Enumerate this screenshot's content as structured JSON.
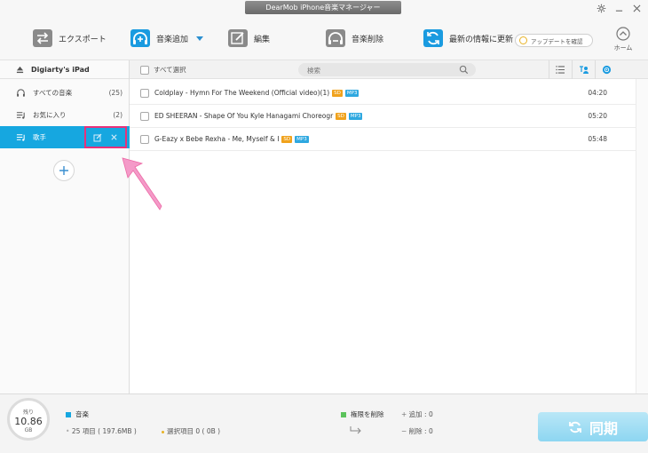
{
  "window": {
    "title": "DearMob iPhone音楽マネージャー"
  },
  "toolbar": {
    "export_label": "エクスポート",
    "add_label": "音楽追加",
    "edit_label": "編集",
    "delete_label": "音楽削除",
    "refresh_label": "最新の情報に更新",
    "update_label": "アップデートを確認",
    "home_label": "ホーム"
  },
  "sidebar": {
    "device": "Digiarty's iPad",
    "items": [
      {
        "label": "すべての音楽",
        "count": "(25)"
      },
      {
        "label": "お気に入り",
        "count": "(2)"
      },
      {
        "label": "歌手",
        "count": ""
      }
    ]
  },
  "content": {
    "select_all": "すべて選択",
    "search_placeholder": "検索",
    "songs": [
      {
        "title": "Coldplay - Hymn For The Weekend (Official video)(1)",
        "quality": "SD",
        "format": "MP3",
        "duration": "04:20"
      },
      {
        "title": "ED SHEERAN - Shape Of You   Kyle Hanagami Choreogr",
        "quality": "SD",
        "format": "MP3",
        "duration": "05:20"
      },
      {
        "title": "G-Eazy x Bebe Rexha - Me, Myself & I",
        "quality": "SD",
        "format": "MP3",
        "duration": "05:48"
      }
    ]
  },
  "footer": {
    "storage_label": "残り",
    "storage_value": "10.86",
    "storage_unit": "GB",
    "music_label": "音楽",
    "music_info": "25 項目 ( 197.6MB )",
    "selected_info": "選択項目 0 ( 0B )",
    "permission_label": "権限を削除",
    "added": "追加 : 0",
    "removed": "削除 : 0",
    "sync_label": "同期"
  },
  "colors": {
    "accent": "#16a7e0",
    "highlight_box": "#e8317a",
    "sd_badge": "#f0a21c",
    "mp3_badge": "#2ea8e0",
    "music_legend": "#16a7e0",
    "permission_legend": "#5cc35c"
  }
}
